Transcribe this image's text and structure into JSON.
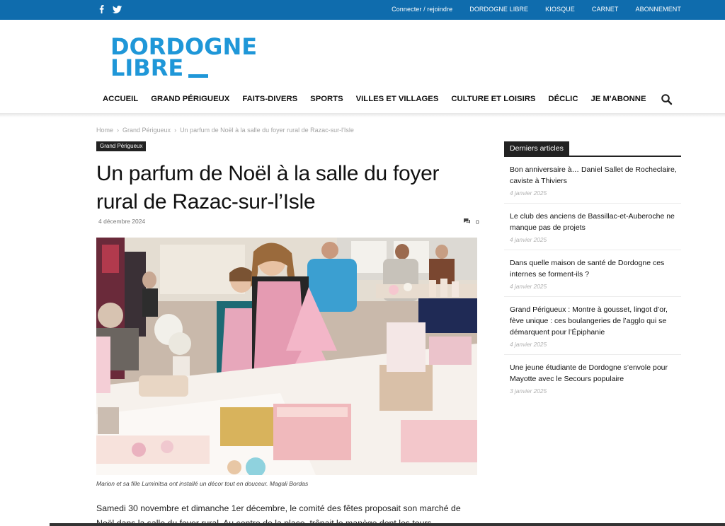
{
  "topbar": {
    "social": [
      "facebook-icon",
      "twitter-icon"
    ],
    "links": [
      "Connecter / rejoindre",
      "DORDOGNE LIBRE",
      "KIOSQUE",
      "CARNET",
      "ABONNEMENT"
    ]
  },
  "logo": {
    "line1": "DORDOGNE",
    "line2": "LIBRE"
  },
  "nav": [
    "ACCUEIL",
    "GRAND PÉRIGUEUX",
    "FAITS-DIVERS",
    "SPORTS",
    "VILLES ET VILLAGES",
    "CULTURE ET LOISIRS",
    "DÉCLIC",
    "JE M'ABONNE"
  ],
  "breadcrumb": [
    "Home",
    "Grand Périgueux",
    "Un parfum de Noël à la salle du foyer rural de Razac-sur-l'Isle"
  ],
  "article": {
    "category": "Grand Périgueux",
    "title": "Un parfum de Noël à la salle du foyer rural de Razac-sur-l’Isle",
    "date": "4 décembre 2024",
    "comments": "0",
    "caption": "Marion et sa fille Luminitsa ont installé un décor tout en douceur. Magali Bordas",
    "body": "Samedi 30 novembre et dimanche 1er décembre, le comité des fêtes proposait son marché de Noël dans la salle du foyer rural. Au centre de la place, trônait le manège dont les tours"
  },
  "sidebar": {
    "title": "Derniers articles",
    "items": [
      {
        "title": "Bon anniversaire à… Daniel Sallet de Rocheclaire, caviste à Thiviers",
        "date": "4 janvier 2025"
      },
      {
        "title": "Le club des anciens de Bassillac-et-Auberoche ne manque pas de projets",
        "date": "4 janvier 2025"
      },
      {
        "title": "Dans quelle maison de santé de Dordogne ces internes se forment-ils ?",
        "date": "4 janvier 2025"
      },
      {
        "title": "Grand Périgueux : Montre à gousset, lingot d’or, fève unique : ces boulangeries de l’agglo qui se démarquent pour l’Épiphanie",
        "date": "4 janvier 2025"
      },
      {
        "title": "Une jeune étudiante de Dordogne s’envole pour Mayotte avec le Secours populaire",
        "date": "3 janvier 2025"
      }
    ]
  },
  "colors": {
    "topbar": "#0f6cad",
    "logo": "#1f97d8",
    "dark": "#222222"
  }
}
